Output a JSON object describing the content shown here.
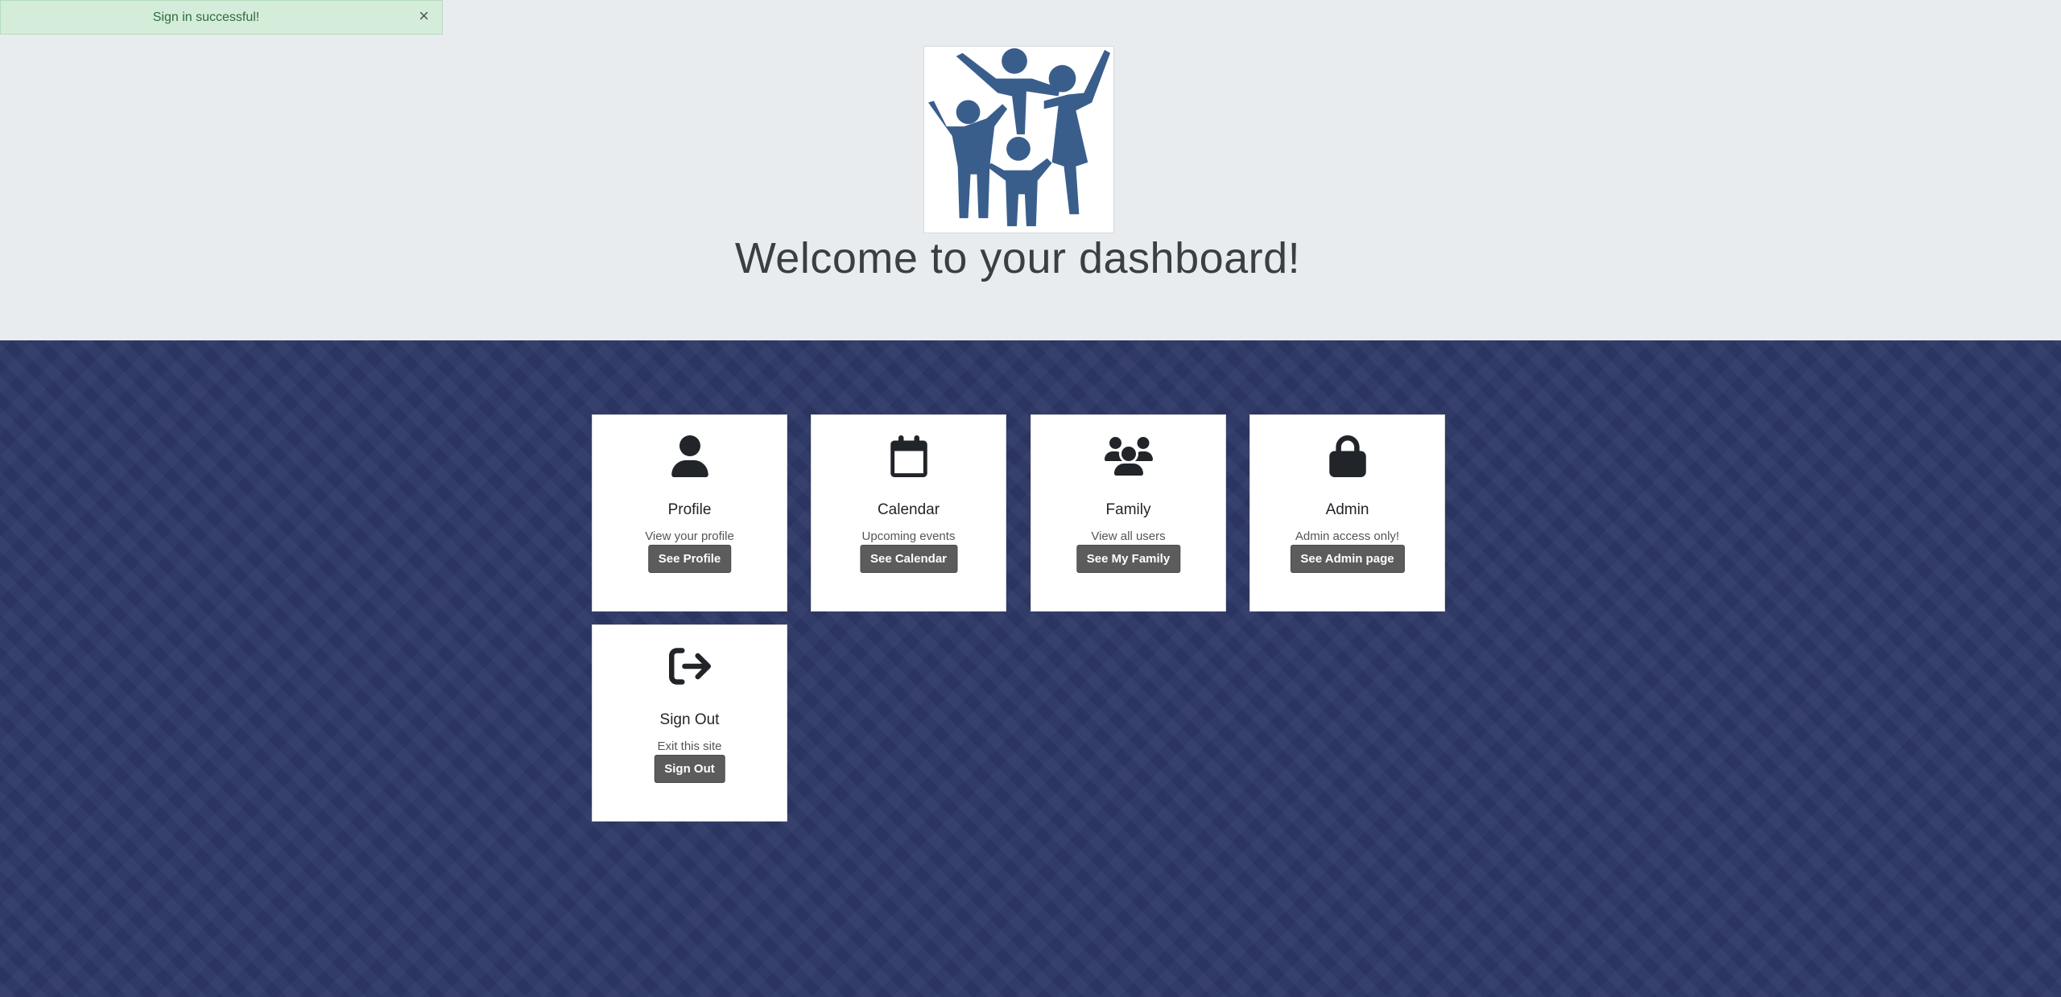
{
  "toast": {
    "message": "Sign in successful!",
    "close_glyph": "×"
  },
  "header": {
    "logo_icon": "family-logo",
    "title": "Welcome to your dashboard!",
    "logo_color": "#3a5e8c"
  },
  "cards": [
    {
      "icon": "user-icon",
      "title": "Profile",
      "text": "View your profile",
      "button": "See Profile"
    },
    {
      "icon": "calendar-icon",
      "title": "Calendar",
      "text": "Upcoming events",
      "button": "See Calendar"
    },
    {
      "icon": "users-icon",
      "title": "Family",
      "text": "View all users",
      "button": "See My Family"
    },
    {
      "icon": "lock-icon",
      "title": "Admin",
      "text": "Admin access only!",
      "button": "See Admin page"
    },
    {
      "icon": "sign-out-icon",
      "title": "Sign Out",
      "text": "Exit this site",
      "button": "Sign Out"
    }
  ]
}
